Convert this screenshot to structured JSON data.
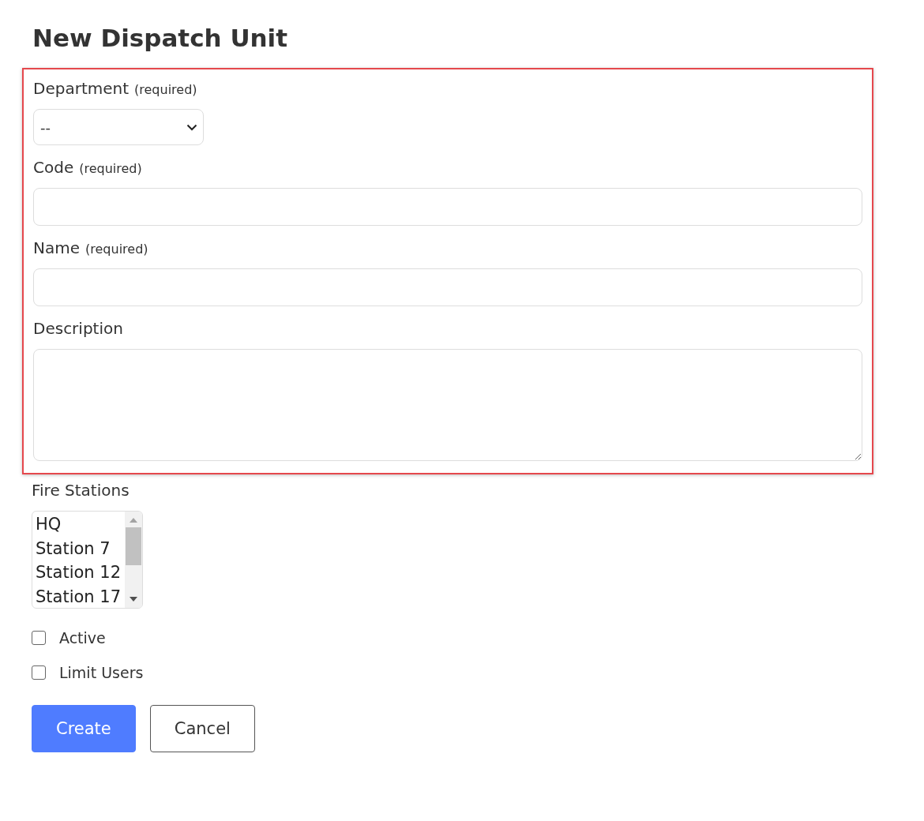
{
  "title": "New Dispatch Unit",
  "fields": [
    {
      "kind": "select",
      "label": "Department",
      "hint": "(required)",
      "value": "--"
    },
    {
      "kind": "text",
      "label": "Code",
      "hint": "(required)"
    },
    {
      "kind": "text",
      "label": "Name",
      "hint": "(required)"
    },
    {
      "kind": "textarea",
      "label": "Description"
    }
  ],
  "fire_stations": {
    "label": "Fire Stations",
    "options": [
      {
        "label": "HQ",
        "selected": false
      },
      {
        "label": "Station 7",
        "selected": false
      },
      {
        "label": "Station 12",
        "selected": false
      },
      {
        "label": "Station 17",
        "selected": false
      }
    ]
  },
  "checkboxes": [
    {
      "label": "Active",
      "checked": false
    },
    {
      "label": "Limit Users",
      "checked": false
    }
  ],
  "buttons": [
    {
      "kind": "primary",
      "label": "Create"
    },
    {
      "kind": "secondary",
      "label": "Cancel"
    }
  ]
}
